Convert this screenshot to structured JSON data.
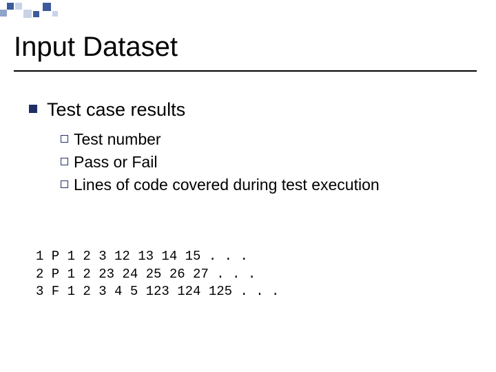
{
  "title": "Input Dataset",
  "bullet1": "Test case results",
  "sub": {
    "a": "Test number",
    "b": "Pass or Fail",
    "c": "Lines of code covered during test execution"
  },
  "rows": {
    "r1": "1 P 1 2 3 12 13 14 15 . . .",
    "r2": "2 P 1 2 23 24 25 26 27 . . .",
    "r3": "3 F 1 2 3 4 5 123 124 125 . . ."
  }
}
